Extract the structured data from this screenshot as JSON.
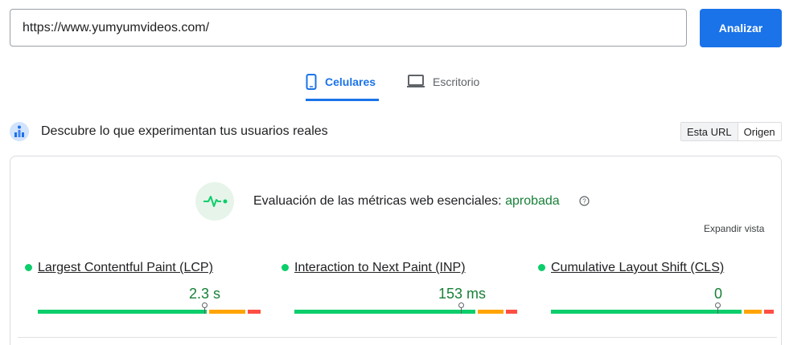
{
  "search": {
    "url_value": "https://www.yumyumvideos.com/",
    "analyze_label": "Analizar"
  },
  "tabs": [
    {
      "label": "Celulares",
      "icon": "smartphone-icon",
      "selected": true
    },
    {
      "label": "Escritorio",
      "icon": "laptop-icon",
      "selected": false
    }
  ],
  "field_data": {
    "title": "Descubre lo que experimentan tus usuarios reales",
    "icon": "field-data-icon",
    "toggle": [
      "Esta URL",
      "Origen"
    ],
    "toggle_selected": "Esta URL"
  },
  "assessment": {
    "label": "Evaluación de las métricas web esenciales:",
    "status": "aprobada",
    "icon": "pulse-icon",
    "help_icon": "help-icon",
    "expand_label": "Expandir vista"
  },
  "metrics": [
    {
      "name": "Largest Contentful Paint (LCP)",
      "value": "2.3 s",
      "rating": "good"
    },
    {
      "name": "Interaction to Next Paint (INP)",
      "value": "153 ms",
      "rating": "good"
    },
    {
      "name": "Cumulative Layout Shift (CLS)",
      "value": "0",
      "rating": "good"
    }
  ],
  "colors": {
    "accent": "#1a73e8",
    "pass_text": "#188038",
    "good": "#0cce6b",
    "needs_improvement": "#ffa400",
    "poor": "#ff4e42"
  }
}
